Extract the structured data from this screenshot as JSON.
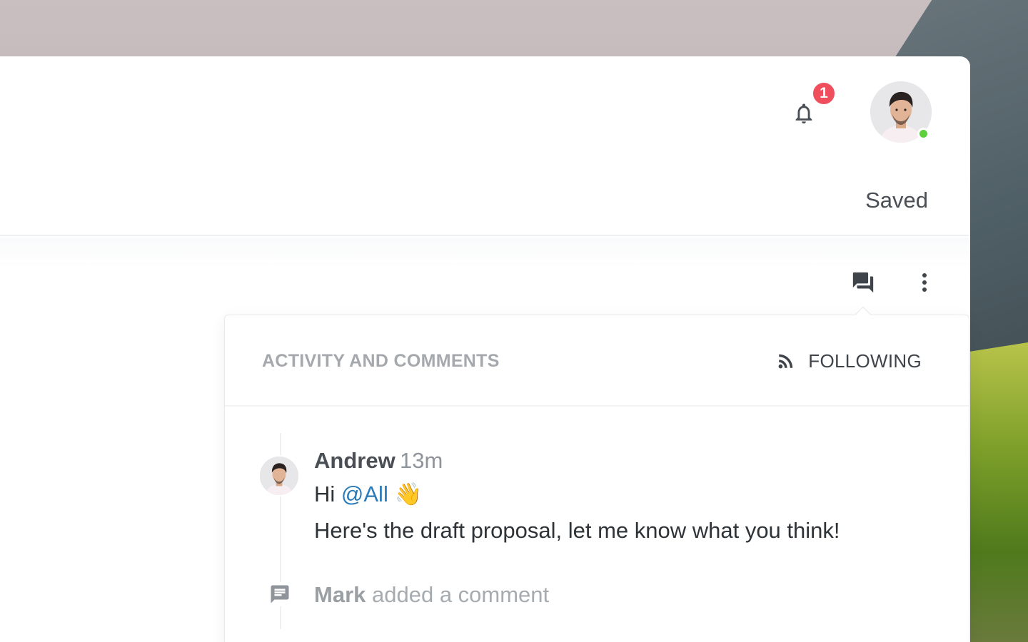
{
  "header": {
    "notification_count": "1",
    "save_status": "Saved",
    "user_online": true
  },
  "toolbar": {
    "comments_icon": "chat-bubbles-icon",
    "more_icon": "more-vertical-icon"
  },
  "activity": {
    "title": "ACTIVITY AND COMMENTS",
    "follow_label": "FOLLOWING",
    "follow_icon": "rss-feed-icon",
    "comment": {
      "author": "Andrew",
      "time": "13m",
      "greeting": "Hi",
      "mention": "@All",
      "emoji": "👋",
      "body": "Here's the draft proposal, let me know what you think!"
    },
    "event": {
      "actor": "Mark",
      "action": "added a comment"
    }
  },
  "colors": {
    "badge": "#ef4f5c",
    "online": "#5fcf3e",
    "mention": "#2b7ab8"
  }
}
